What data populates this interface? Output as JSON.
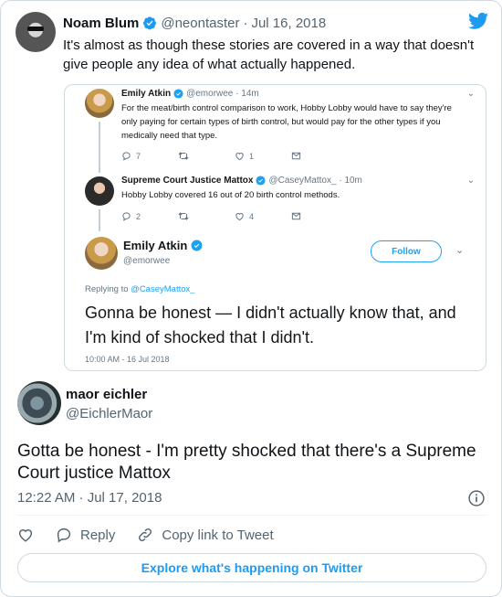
{
  "top_tweet": {
    "name": "Noam Blum",
    "handle": "@neontaster",
    "separator": "·",
    "date": "Jul 16, 2018",
    "text": "It's almost as though these stories are covered in a way that doesn't give people any idea of what actually happened."
  },
  "embedded": {
    "tweet1": {
      "name": "Emily Atkin",
      "handle": "@emorwee · 14m",
      "text": "For the meat/birth control comparison to work, Hobby Lobby would have to say they're only paying for certain types of birth control, but would pay for the other types if you medically need that type.",
      "replies": "7",
      "likes": "1"
    },
    "tweet2": {
      "name": "Supreme Court Justice Mattox",
      "handle": "@CaseyMattox_ · 10m",
      "text": "Hobby Lobby covered 16 out of 20 birth control methods.",
      "replies": "2",
      "likes": "4"
    },
    "main": {
      "name": "Emily Atkin",
      "handle": "@emorwee",
      "follow_label": "Follow",
      "replying_prefix": "Replying to",
      "replying_to": "@CaseyMattox_",
      "text": "Gonna be honest — I didn't actually know that, and I'm kind of shocked that I didn't.",
      "time": "10:00 AM - 16 Jul 2018"
    }
  },
  "reply_tweet": {
    "name": "maor eichler",
    "handle": "@EichlerMaor",
    "text": "Gotta be honest - I'm pretty shocked that there's a Supreme Court justice Mattox",
    "time": "12:22 AM · Jul 17, 2018",
    "reply_label": "Reply",
    "copy_label": "Copy link to Tweet",
    "explore_label": "Explore what's happening on Twitter"
  },
  "colors": {
    "twitter_blue": "#1d9bf0",
    "text_primary": "#0f1419",
    "text_secondary": "#536471",
    "border": "#cfd9de"
  },
  "icons": [
    "verified-badge-icon",
    "twitter-bird-icon",
    "reply-icon",
    "retweet-icon",
    "like-icon",
    "message-icon",
    "chevron-down-icon",
    "info-icon",
    "heart-icon",
    "link-icon"
  ]
}
